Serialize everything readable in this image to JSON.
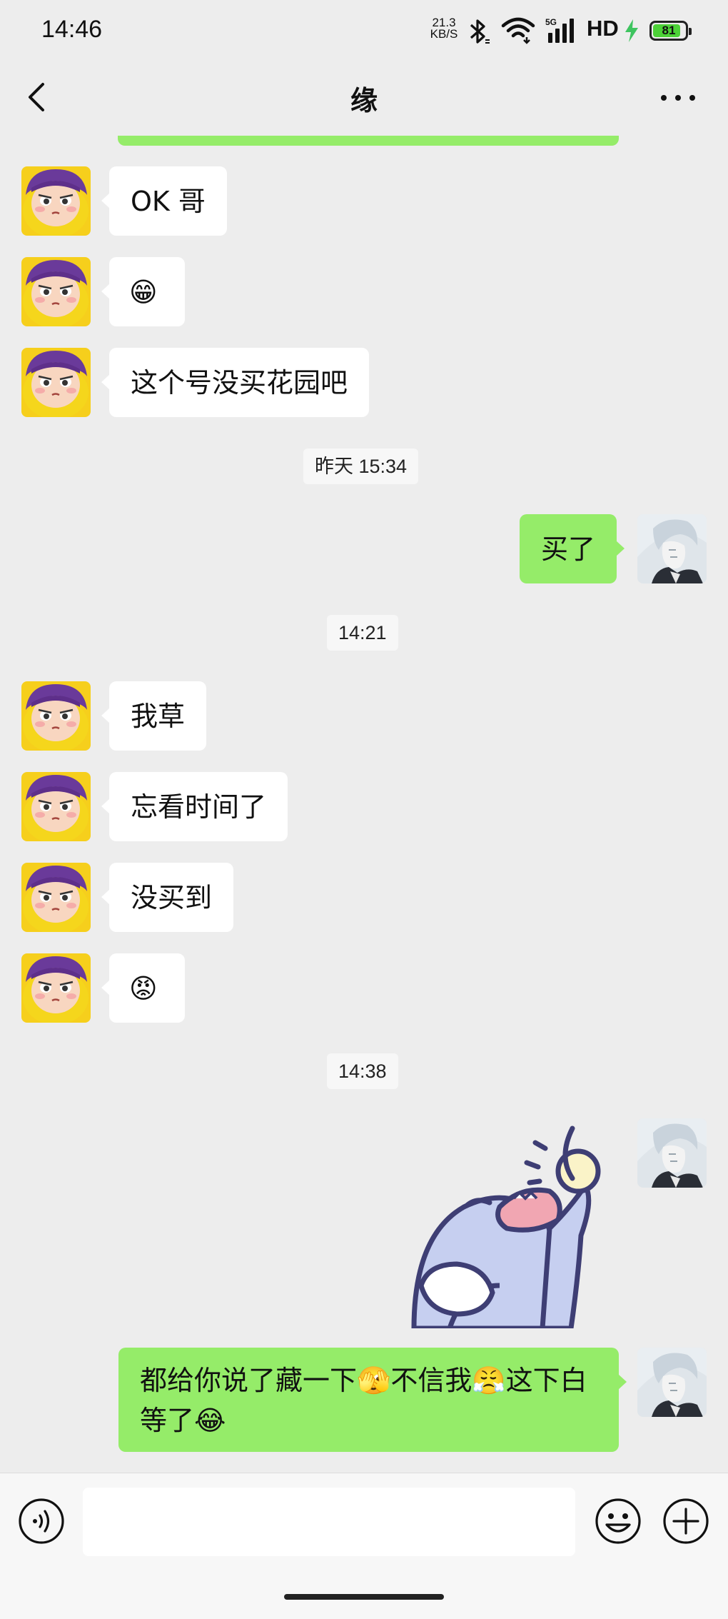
{
  "status_bar": {
    "time": "14:46",
    "net_speed_value": "21.3",
    "net_speed_unit": "KB/S",
    "network_type": "5G",
    "hd": "HD",
    "battery": "81"
  },
  "header": {
    "title": "缘"
  },
  "messages": [
    {
      "side": "in",
      "text": "OK 哥"
    },
    {
      "side": "in",
      "text": "😁"
    },
    {
      "side": "in",
      "text": "这个号没买花园吧"
    },
    {
      "timestamp": "昨天 15:34"
    },
    {
      "side": "out",
      "text": "买了"
    },
    {
      "timestamp": "14:21"
    },
    {
      "side": "in",
      "text": "我草"
    },
    {
      "side": "in",
      "text": "忘看时间了"
    },
    {
      "side": "in",
      "text": "没买到"
    },
    {
      "side": "in",
      "text": "😡"
    },
    {
      "timestamp": "14:38"
    },
    {
      "side": "out",
      "sticker": "dolphin-6-sticker"
    },
    {
      "side": "out",
      "text_line1": "都给你说了藏一下🫣不信我😤这下白",
      "text_line2": "等了😂"
    }
  ],
  "colors": {
    "background": "#ededed",
    "outgoing_bubble": "#95ec69",
    "incoming_bubble": "#ffffff",
    "input_bar": "#f7f7f7"
  },
  "input_bar": {
    "voice_icon": "voice-icon",
    "emoji_icon": "emoji-icon",
    "plus_icon": "plus-icon"
  }
}
